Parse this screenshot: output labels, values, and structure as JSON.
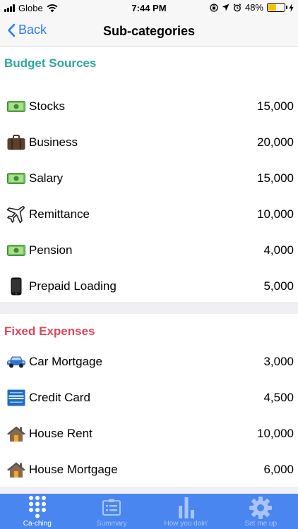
{
  "status": {
    "carrier": "Globe",
    "time": "7:44 PM",
    "battery": "48%",
    "battery_level": 0.48
  },
  "nav": {
    "back_label": "Back",
    "title": "Sub-categories"
  },
  "budget_sources": {
    "title": "Budget Sources",
    "items": [
      {
        "label": "Stocks",
        "amount": "15,000",
        "icon": "money-icon"
      },
      {
        "label": "Business",
        "amount": "20,000",
        "icon": "briefcase-icon"
      },
      {
        "label": "Salary",
        "amount": "15,000",
        "icon": "money-icon"
      },
      {
        "label": "Remittance",
        "amount": "10,000",
        "icon": "airplane-icon"
      },
      {
        "label": "Pension",
        "amount": "4,000",
        "icon": "money-icon"
      },
      {
        "label": "Prepaid Loading",
        "amount": "5,000",
        "icon": "phone-icon"
      }
    ]
  },
  "fixed_expenses": {
    "title": "Fixed Expenses",
    "items": [
      {
        "label": "Car Mortgage",
        "amount": "3,000",
        "icon": "car-icon"
      },
      {
        "label": "Credit Card",
        "amount": "4,500",
        "icon": "credit-card-icon"
      },
      {
        "label": "House Rent",
        "amount": "10,000",
        "icon": "house-icon"
      },
      {
        "label": "House Mortgage",
        "amount": "6,000",
        "icon": "house-icon"
      }
    ]
  },
  "tabs": [
    {
      "label": "Ca-ching",
      "icon": "keypad-icon"
    },
    {
      "label": "Summary",
      "icon": "clipboard-icon"
    },
    {
      "label": "How you doin'",
      "icon": "bar-chart-icon"
    },
    {
      "label": "Set me up",
      "icon": "gear-icon"
    }
  ],
  "colors": {
    "accent": "#2a7bf6",
    "budget_header": "#2aa898",
    "expense_header": "#e0455f",
    "tab_bar": "#4a86f0"
  }
}
